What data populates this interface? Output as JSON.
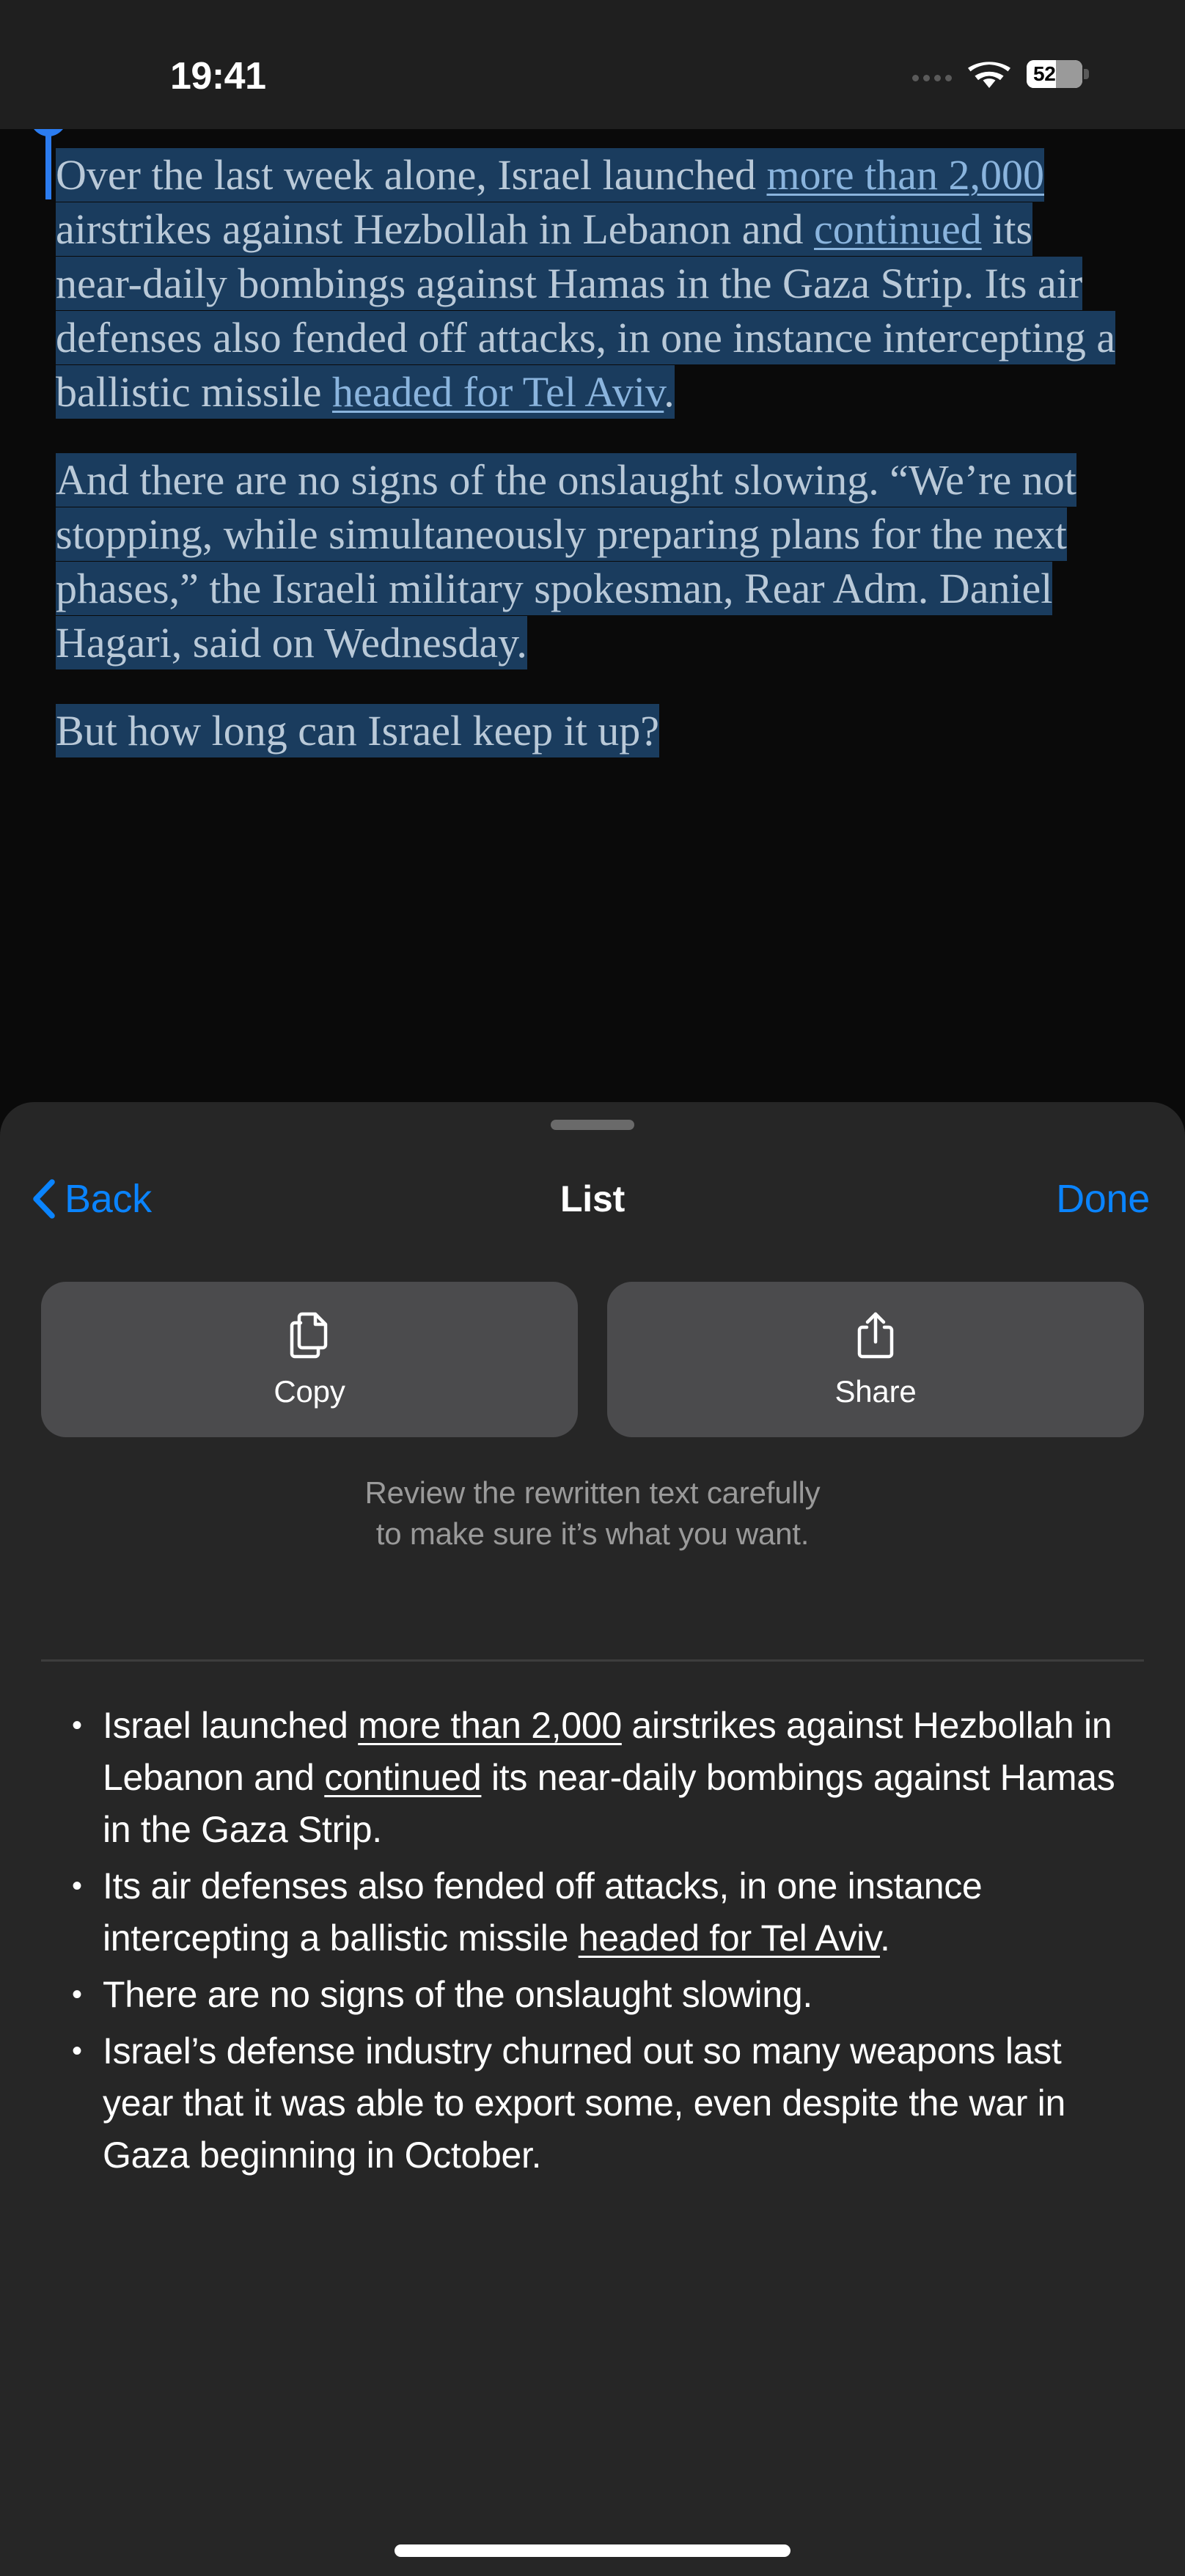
{
  "status_bar": {
    "time": "19:41",
    "battery_level": "52",
    "battery_percent": 52,
    "wifi_icon": "wifi-icon",
    "cellular_icon": "cellular-dots-icon",
    "battery_icon": "battery-icon"
  },
  "article": {
    "paragraphs": [
      {
        "runs": [
          {
            "text": "Over the last week alone, Israel launched ",
            "type": "text"
          },
          {
            "text": "more than 2,000",
            "type": "link"
          },
          {
            "text": " airstrikes against Hezbollah in Lebanon and ",
            "type": "text"
          },
          {
            "text": "continued",
            "type": "link"
          },
          {
            "text": " its near-daily bombings against Hamas in the Gaza Strip. Its air defenses also fended off attacks, in one instance intercepting a ballistic missile ",
            "type": "text"
          },
          {
            "text": "headed for Tel Aviv",
            "type": "link"
          },
          {
            "text": ".",
            "type": "text"
          }
        ]
      },
      {
        "runs": [
          {
            "text": "And there are no signs of the onslaught slowing. “We’re not stopping, while simultaneously preparing plans for the next phases,” the Israeli military spokesman, Rear Adm. Daniel Hagari, said on Wednesday.",
            "type": "text"
          }
        ]
      },
      {
        "runs": [
          {
            "text": "But how long can Israel keep it up?",
            "type": "text"
          }
        ]
      }
    ],
    "selection_highlight_color": "#1a3c5e",
    "link_color": "#8ab4dd",
    "text_color": "#b9c9d8",
    "selection_handle_color": "#2b7cf0"
  },
  "sheet": {
    "title": "List",
    "back_label": "Back",
    "done_label": "Done",
    "accent_color": "#0a84ff",
    "background_color": "#262626",
    "grabber_name": "sheet-grabber",
    "actions": [
      {
        "label": "Copy",
        "icon": "copy-icon"
      },
      {
        "label": "Share",
        "icon": "share-icon"
      }
    ],
    "disclaimer_line1": "Review the rewritten text carefully",
    "disclaimer_line2": "to make sure it’s what you want.",
    "bullets": [
      {
        "runs": [
          {
            "text": "Israel launched ",
            "type": "text"
          },
          {
            "text": "more than 2,000",
            "type": "underline"
          },
          {
            "text": " airstrikes against Hezbollah in Lebanon and ",
            "type": "text"
          },
          {
            "text": "continued",
            "type": "underline"
          },
          {
            "text": " its near-daily bombings against Hamas in the Gaza Strip.",
            "type": "text"
          }
        ]
      },
      {
        "runs": [
          {
            "text": "Its air defenses also fended off attacks, in one instance intercepting a ballistic missile ",
            "type": "text"
          },
          {
            "text": "headed for Tel Aviv",
            "type": "underline"
          },
          {
            "text": ".",
            "type": "text"
          }
        ]
      },
      {
        "runs": [
          {
            "text": "There are no signs of the onslaught slowing.",
            "type": "text"
          }
        ]
      },
      {
        "runs": [
          {
            "text": "Israel’s defense industry churned out so many weapons last year that it was able to export some, even despite the war in Gaza beginning in October.",
            "type": "text"
          }
        ]
      }
    ]
  }
}
